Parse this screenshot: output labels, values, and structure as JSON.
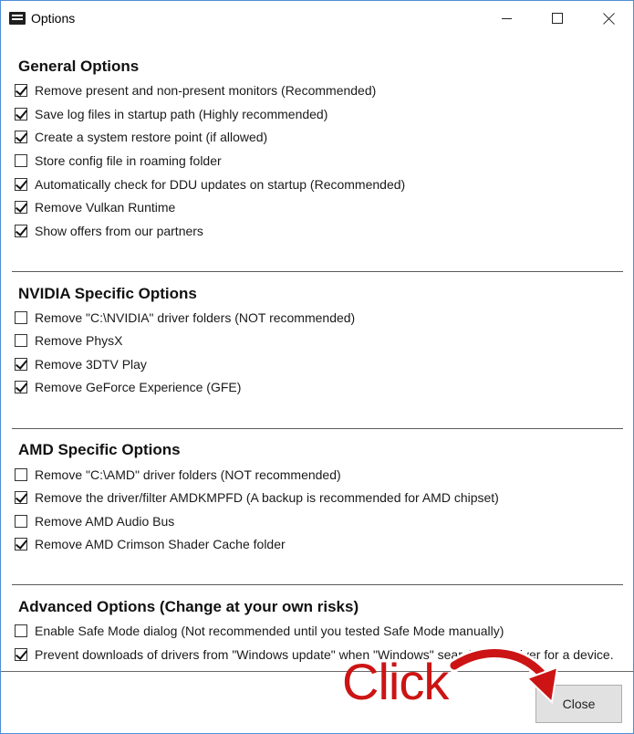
{
  "window": {
    "title": "Options",
    "controls": [
      "minimize",
      "maximize",
      "close"
    ]
  },
  "sections": [
    {
      "title": "General Options",
      "options": [
        {
          "label": "Remove present and non-present monitors (Recommended)",
          "checked": true
        },
        {
          "label": "Save log files in startup path (Highly recommended)",
          "checked": true
        },
        {
          "label": "Create a system restore point (if allowed)",
          "checked": true
        },
        {
          "label": "Store config file in roaming folder",
          "checked": false
        },
        {
          "label": "Automatically check for DDU updates on startup (Recommended)",
          "checked": true
        },
        {
          "label": "Remove Vulkan Runtime",
          "checked": true
        },
        {
          "label": "Show offers from our partners",
          "checked": true
        }
      ]
    },
    {
      "title": "NVIDIA Specific Options",
      "options": [
        {
          "label": "Remove \"C:\\NVIDIA\" driver folders (NOT recommended)",
          "checked": false
        },
        {
          "label": "Remove PhysX",
          "checked": false
        },
        {
          "label": "Remove 3DTV Play",
          "checked": true
        },
        {
          "label": "Remove GeForce Experience (GFE)",
          "checked": true
        }
      ]
    },
    {
      "title": "AMD Specific Options",
      "options": [
        {
          "label": "Remove \"C:\\AMD\" driver folders (NOT recommended)",
          "checked": false
        },
        {
          "label": "Remove the driver/filter AMDKMPFD (A backup is recommended for AMD chipset)",
          "checked": true
        },
        {
          "label": "Remove AMD Audio Bus",
          "checked": false
        },
        {
          "label": "Remove AMD Crimson Shader Cache folder",
          "checked": true
        }
      ]
    },
    {
      "title": "Advanced Options (Change at your own risks)",
      "options": [
        {
          "label": "Enable Safe Mode dialog (Not recommended until you tested Safe Mode manually)",
          "checked": false
        },
        {
          "label": "Prevent downloads of drivers from \"Windows update\" when \"Windows\" search for a driver for a device.",
          "checked": true
        }
      ]
    }
  ],
  "footer": {
    "close_label": "Close"
  },
  "annotation": {
    "callout_text": "Click",
    "color": "#cc1414"
  }
}
